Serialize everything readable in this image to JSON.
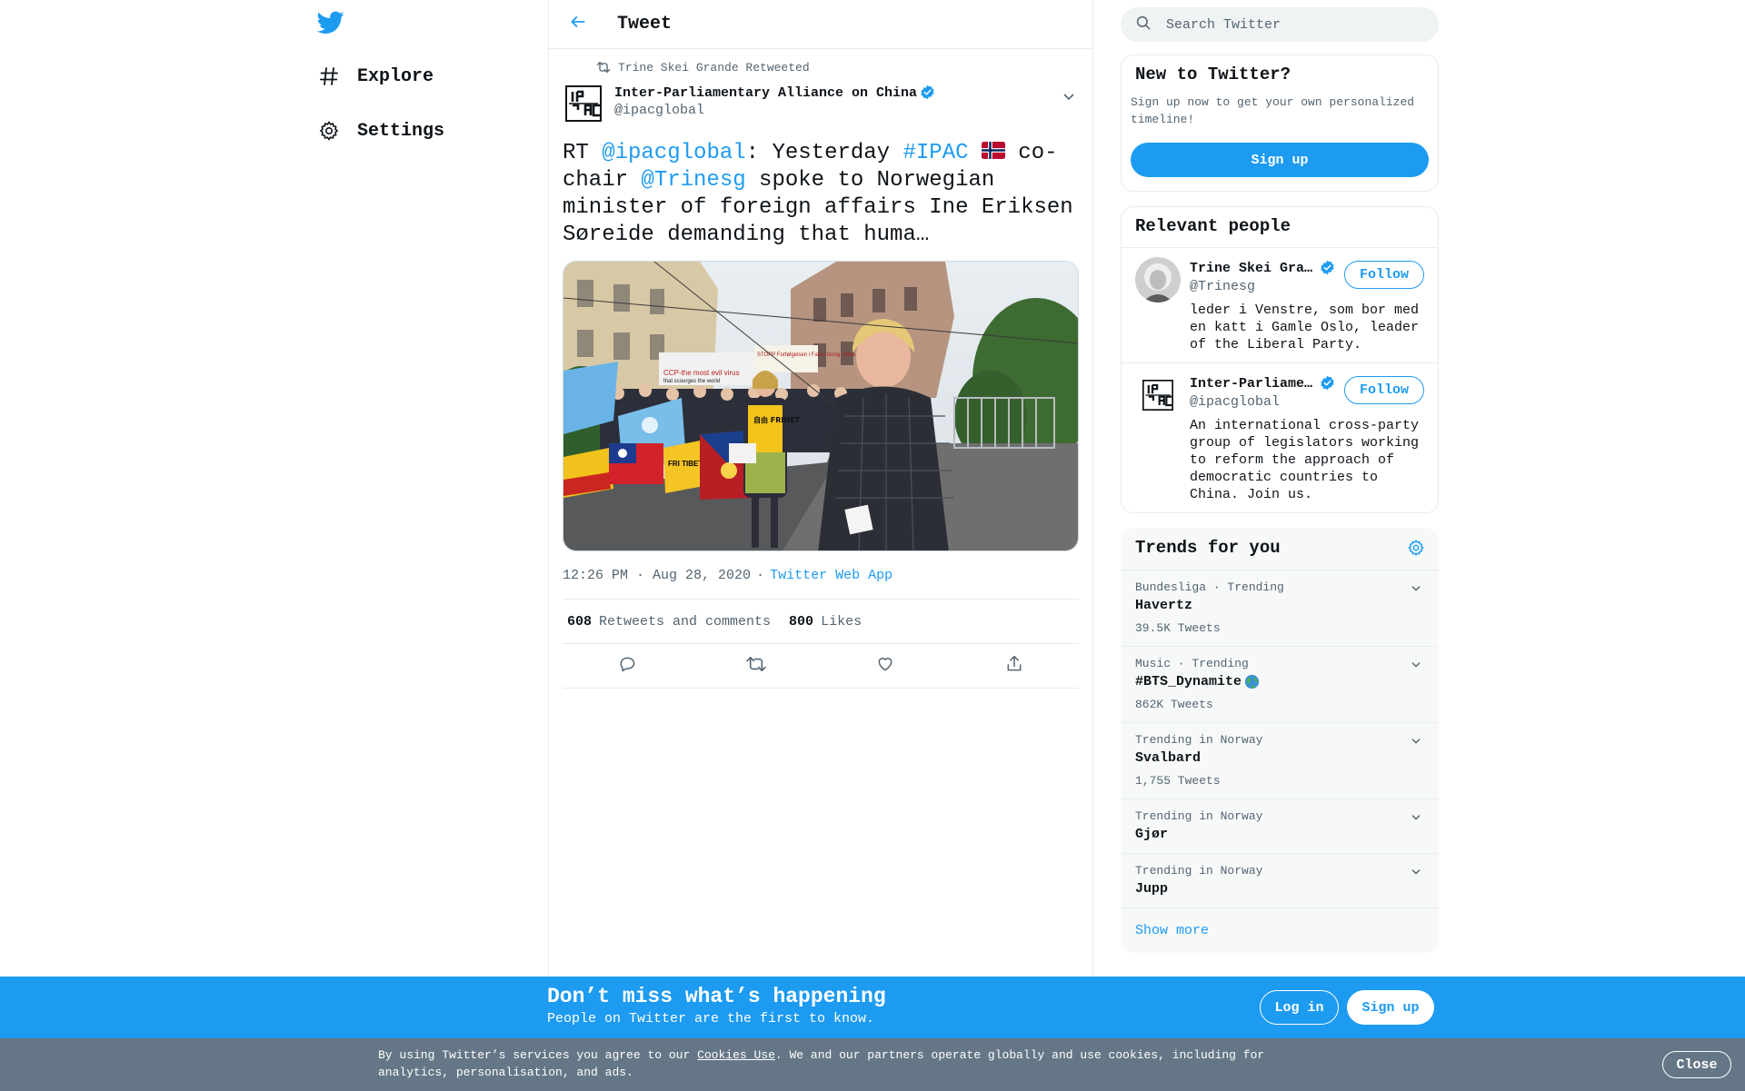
{
  "colors": {
    "accent": "#1d9bf0",
    "text": "#0f1419",
    "secondary": "#536471",
    "cookie_bg": "#657786"
  },
  "nav": {
    "logo_icon": "twitter-bird-icon",
    "items": [
      {
        "label": "Explore",
        "icon": "hashtag-icon"
      },
      {
        "label": "Settings",
        "icon": "gear-icon"
      }
    ]
  },
  "header": {
    "back_icon": "arrow-left-icon",
    "title": "Tweet"
  },
  "tweet": {
    "retweeted_by": "Trine Skei Grande Retweeted",
    "author_name": "Inter-Parliamentary Alliance on China",
    "author_handle": "@ipacglobal",
    "text": {
      "p1": "RT ",
      "m1": "@ipacglobal",
      "p2": ": Yesterday ",
      "h1": "#IPAC",
      "p3": " co-chair ",
      "m2": "@Trinesg",
      "p4": " spoke to Norwegian minister of foreign affairs Ine Eriksen Søreide demanding that huma…"
    },
    "media_text": {
      "banner1": "CCP-the most evil virus",
      "banner1b": "that scourges the world",
      "banner2": "STOPP Forfølgelsen i Falun Gong i Kina",
      "flag_text": "FRI TIBET",
      "shirt": "自由 FRIHET"
    },
    "time": "12:26 PM · Aug 28, 2020",
    "separator": "·",
    "source": "Twitter Web App",
    "retweets_count": "608",
    "retweets_label": "Retweets and comments",
    "likes_count": "800",
    "likes_label": "Likes"
  },
  "search": {
    "placeholder": "Search Twitter"
  },
  "new_to_twitter": {
    "title": "New to Twitter?",
    "description": "Sign up now to get your own personalized timeline!",
    "signup_label": "Sign up"
  },
  "relevant_people": {
    "title": "Relevant people",
    "people": [
      {
        "name": "Trine Skei Grande",
        "handle": "@Trinesg",
        "bio": "leder i Venstre, som bor med en katt i Gamle Oslo, leader of the Liberal Party.",
        "follow_label": "Follow"
      },
      {
        "name": "Inter-Parliamentary Alliance on China",
        "handle": "@ipacglobal",
        "bio": "An international cross-party group of legislators working to reform the approach of democratic countries to China. Join us.",
        "follow_label": "Follow"
      }
    ]
  },
  "trends": {
    "title": "Trends for you",
    "items": [
      {
        "meta": "Bundesliga · Trending",
        "name": "Havertz",
        "count": "39.5K Tweets"
      },
      {
        "meta": "Music · Trending",
        "name": "#BTS_Dynamite",
        "count": "862K Tweets"
      },
      {
        "meta": "Trending in Norway",
        "name": "Svalbard",
        "count": "1,755 Tweets"
      },
      {
        "meta": "Trending in Norway",
        "name": "Gjør",
        "count": ""
      },
      {
        "meta": "Trending in Norway",
        "name": "Jupp",
        "count": ""
      }
    ],
    "show_more": "Show more"
  },
  "banner": {
    "title": "Don’t miss what’s happening",
    "subtitle": "People on Twitter are the first to know.",
    "login_label": "Log in",
    "signup_label": "Sign up"
  },
  "cookie": {
    "pre": "By using Twitter’s services you agree to our ",
    "link": "Cookies Use",
    "post": ". We and our partners operate globally and use cookies, including for analytics, personalisation, and ads.",
    "close_label": "Close"
  }
}
